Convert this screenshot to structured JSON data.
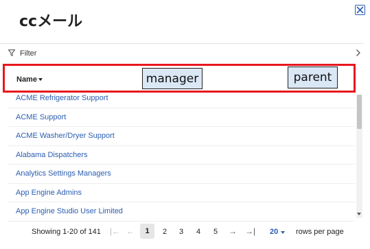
{
  "dialog": {
    "title": "ccメール",
    "close_icon": "close-icon"
  },
  "filter": {
    "label": "Filter",
    "icon": "filter-icon",
    "chevron": "chevron-right-icon"
  },
  "table": {
    "column_header": "Name",
    "sort_icon": "caret-down-icon",
    "rows": [
      "ACME Refrigerator Support",
      "ACME Support",
      "ACME Washer/Dryer Support",
      "Alabama Dispatchers",
      "Analytics Settings Managers",
      "App Engine Admins",
      "App Engine Studio User Limited"
    ]
  },
  "annotations": {
    "manager": "manager",
    "parent": "parent",
    "highlight_color": "#e8171d",
    "tag_color": "#dae7f5"
  },
  "pagination": {
    "showing": "Showing 1-20 of 141",
    "pages": [
      "1",
      "2",
      "3",
      "4",
      "5"
    ],
    "current_page": "1",
    "per_page": "20",
    "rows_per_page_label": "rows per page"
  },
  "colors": {
    "link": "#2a5db0"
  }
}
